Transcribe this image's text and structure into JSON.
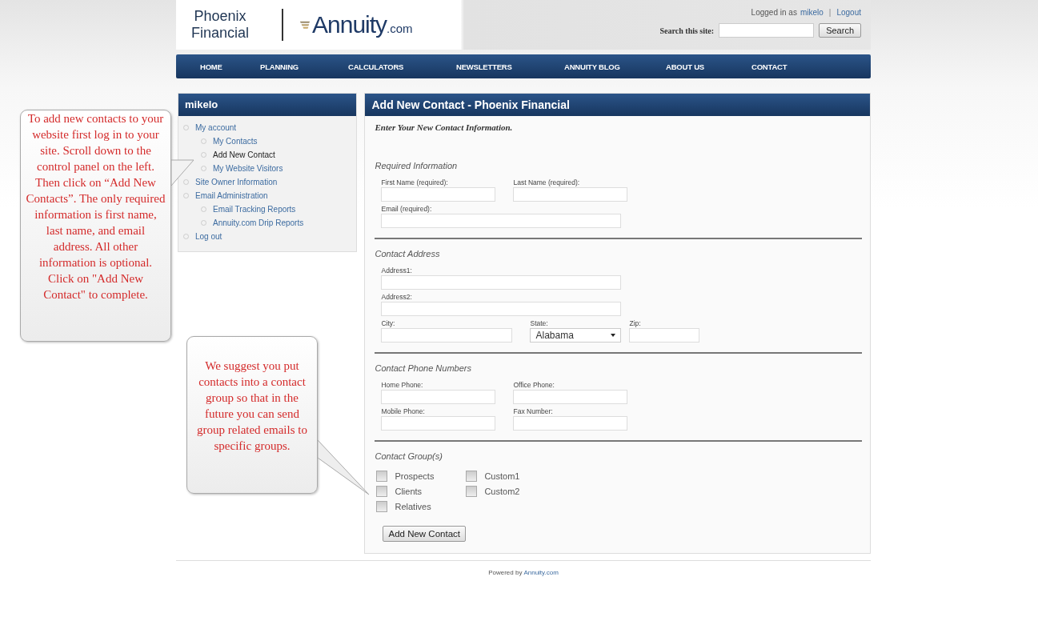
{
  "header": {
    "logo_left": [
      "Phoenix",
      "Financial"
    ],
    "logo_right": {
      "name": "Annuity",
      "suffix": ".com"
    },
    "login": {
      "prefix": "Logged in as",
      "user": "mikelo",
      "separator": "|",
      "logout": "Logout"
    },
    "search": {
      "label": "Search this site:",
      "button": "Search"
    }
  },
  "nav": [
    "HOME",
    "PLANNING",
    "CALCULATORS",
    "NEWSLETTERS",
    "ANNUITY BLOG",
    "ABOUT US",
    "CONTACT"
  ],
  "sidebar": {
    "title": "mikelo",
    "items": [
      {
        "label": "My account",
        "selected": false,
        "children": [
          {
            "label": "My Contacts",
            "selected": false
          },
          {
            "label": "Add New Contact",
            "selected": true
          },
          {
            "label": "My Website Visitors",
            "selected": false
          }
        ]
      },
      {
        "label": "Site Owner Information",
        "selected": false
      },
      {
        "label": "Email Administration",
        "selected": false,
        "children": [
          {
            "label": "Email Tracking Reports",
            "selected": false
          },
          {
            "label": "Annuity.com Drip Reports",
            "selected": false
          }
        ]
      },
      {
        "label": "Log out",
        "selected": false
      }
    ]
  },
  "main": {
    "title": "Add New Contact - Phoenix Financial",
    "intro": "Enter Your New Contact Information.",
    "sections": [
      {
        "heading": "Required Information",
        "rows": [
          [
            {
              "kind": "text",
              "label": "First Name (required):"
            },
            {
              "kind": "text",
              "label": "Last Name (required):"
            }
          ],
          [
            {
              "kind": "text",
              "label": "Email (required):"
            }
          ]
        ]
      },
      {
        "heading": "Contact Address",
        "rows": [
          [
            {
              "kind": "text",
              "label": "Address1:"
            }
          ],
          [
            {
              "kind": "text",
              "label": "Address2:"
            }
          ],
          [
            {
              "kind": "text",
              "label": "City:"
            },
            {
              "kind": "select",
              "label": "State:",
              "value": "Alabama"
            },
            {
              "kind": "text",
              "label": "Zip:"
            }
          ]
        ]
      },
      {
        "heading": "Contact Phone Numbers",
        "rows": [
          [
            {
              "kind": "text",
              "label": "Home Phone:"
            },
            {
              "kind": "text",
              "label": "Office Phone:"
            }
          ],
          [
            {
              "kind": "text",
              "label": "Mobile Phone:"
            },
            {
              "kind": "text",
              "label": "Fax Number:"
            }
          ]
        ]
      },
      {
        "heading": "Contact Group(s)",
        "groups": [
          [
            {
              "label": "Prospects",
              "checked": false
            },
            {
              "label": "Clients",
              "checked": false
            },
            {
              "label": "Relatives",
              "checked": false
            }
          ],
          [
            {
              "label": "Custom1",
              "checked": false
            },
            {
              "label": "Custom2",
              "checked": false
            }
          ]
        ]
      }
    ],
    "button": "Add New Contact"
  },
  "callouts": [
    {
      "text": "To add new contacts to your website first log in to your site.  Scroll down to the control panel on the left. Then click on “Add New Contacts”.  The only required information is first name, last name, and email address.  All other information is optional. Click on \"Add New Contact\" to complete."
    },
    {
      "text": "We suggest you put contacts into a contact group so that in the future you can send group related emails to specific groups."
    }
  ],
  "footer": {
    "prefix": "Powered by",
    "link": "Annuity.com"
  }
}
